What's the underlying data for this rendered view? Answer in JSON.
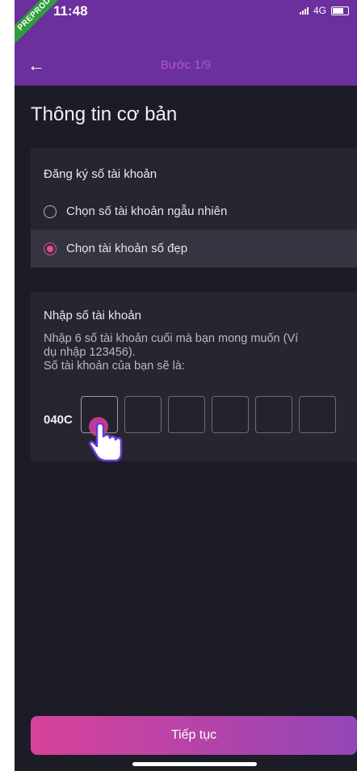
{
  "status_bar": {
    "time": "11:48",
    "network": "4G",
    "ribbon": "PREPROD"
  },
  "header": {
    "step": "Bước 1/9"
  },
  "page": {
    "title": "Thông tin cơ bản"
  },
  "register_card": {
    "heading": "Đăng ký số tài khoản",
    "options": [
      {
        "label": "Chọn số tài khoản ngẫu nhiên",
        "selected": false
      },
      {
        "label": "Chọn tài khoản số đẹp",
        "selected": true
      }
    ]
  },
  "number_card": {
    "heading": "Nhập số tài khoản",
    "description_lines": [
      "Nhập 6 số tài khoản cuối mà bạn mong muốn (Ví",
      "dụ nhập 123456).",
      "Số tài khoản của bạn sẽ là:"
    ],
    "prefix": "040C",
    "digit_count": 6
  },
  "footer": {
    "continue_label": "Tiếp tục"
  },
  "colors": {
    "header_bg": "#6b2f9e",
    "accent_pink": "#ec4b8d",
    "button_gradient_start": "#d8429a",
    "button_gradient_end": "#9346b6"
  },
  "icons": [
    "back-arrow-icon",
    "signal-icon",
    "battery-icon",
    "touch-hand-icon"
  ]
}
